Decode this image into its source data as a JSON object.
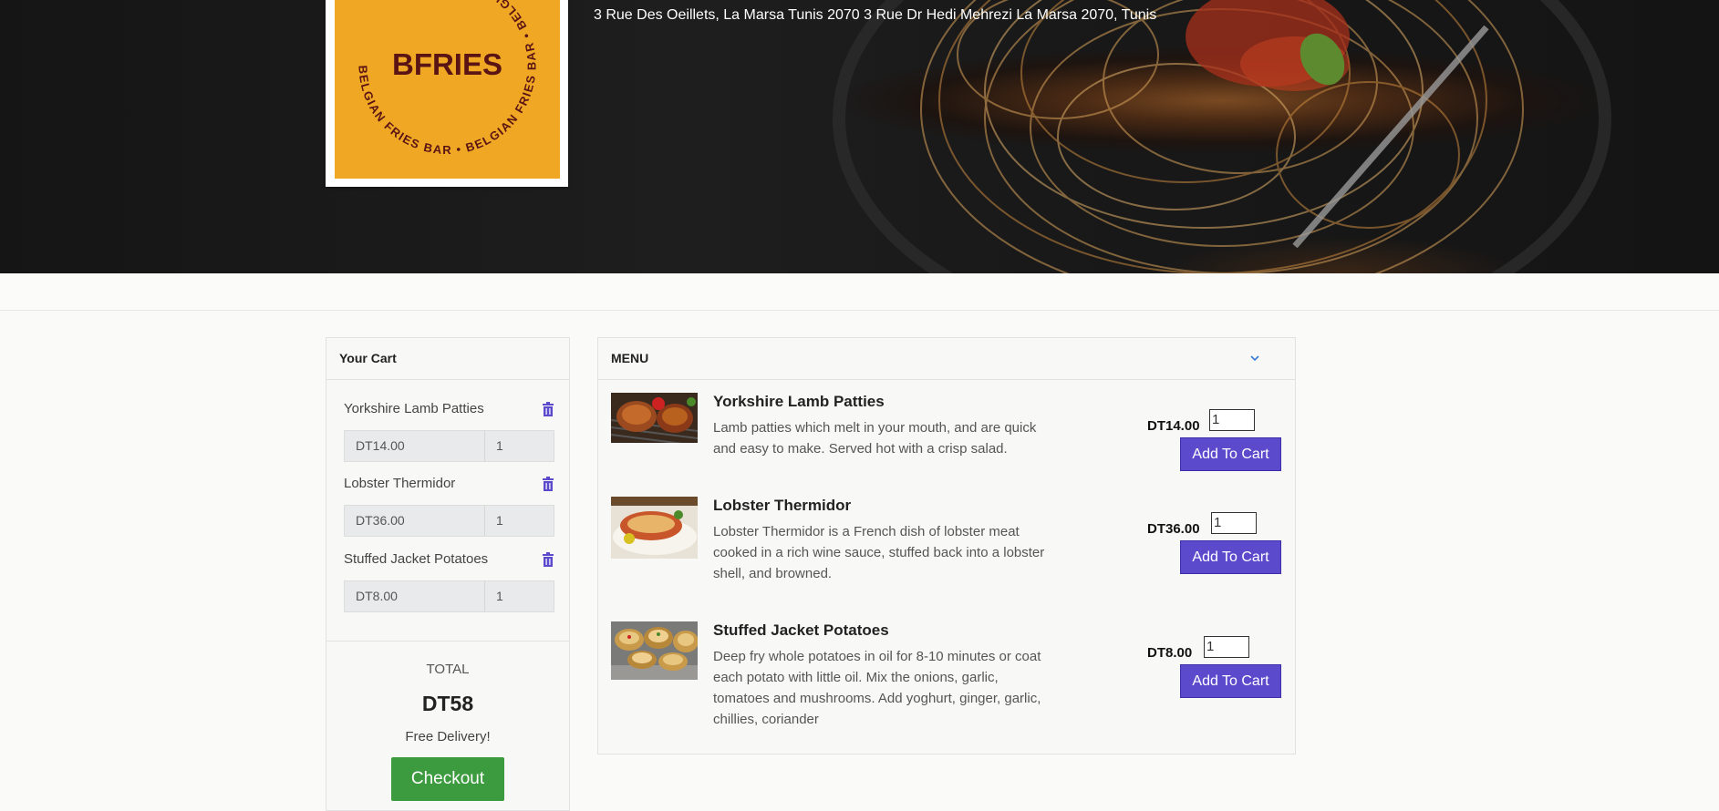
{
  "hero": {
    "address": "3 Rue Des Oeillets, La Marsa Tunis 2070 3 Rue Dr Hedi Mehrezi La Marsa 2070, Tunis"
  },
  "logo": {
    "brand": "BFRIES",
    "ring_text": "BELGIAN FRIES BAR • BELGIAN FRIES BAR • BELGIAN FRIES BAR •",
    "bg_color": "#f0a824",
    "ink_color": "#5a1414"
  },
  "cart": {
    "title": "Your Cart",
    "items": [
      {
        "name": "Yorkshire Lamb Patties",
        "price": "DT14.00",
        "qty": "1",
        "icon": "trash-icon"
      },
      {
        "name": "Lobster Thermidor",
        "price": "DT36.00",
        "qty": "1",
        "icon": "trash-icon"
      },
      {
        "name": "Stuffed Jacket Potatoes",
        "price": "DT8.00",
        "qty": "1",
        "icon": "trash-icon"
      }
    ],
    "total_label": "TOTAL",
    "total_value": "DT58",
    "delivery_note": "Free Delivery!",
    "checkout_label": "Checkout"
  },
  "menu": {
    "title": "MENU",
    "toggle_icon": "chevron-down-icon",
    "items": [
      {
        "name": "Yorkshire Lamb Patties",
        "description": "Lamb patties which melt in your mouth, and are quick and easy to make. Served hot with a crisp salad.",
        "price": "DT14.00",
        "qty": "1",
        "button": "Add To Cart"
      },
      {
        "name": "Lobster Thermidor",
        "description": "Lobster Thermidor is a French dish of lobster meat cooked in a rich wine sauce, stuffed back into a lobster shell, and browned.",
        "price": "DT36.00",
        "qty": "1",
        "button": "Add To Cart"
      },
      {
        "name": "Stuffed Jacket Potatoes",
        "description": "Deep fry whole potatoes in oil for 8-10 minutes or coat each potato with little oil. Mix the onions, garlic, tomatoes and mushrooms. Add yoghurt, ginger, garlic, chillies, coriander",
        "price": "DT8.00",
        "qty": "1",
        "button": "Add To Cart"
      }
    ]
  },
  "colors": {
    "accent_button": "#5b4bcc",
    "checkout_green": "#3c9a3f"
  }
}
